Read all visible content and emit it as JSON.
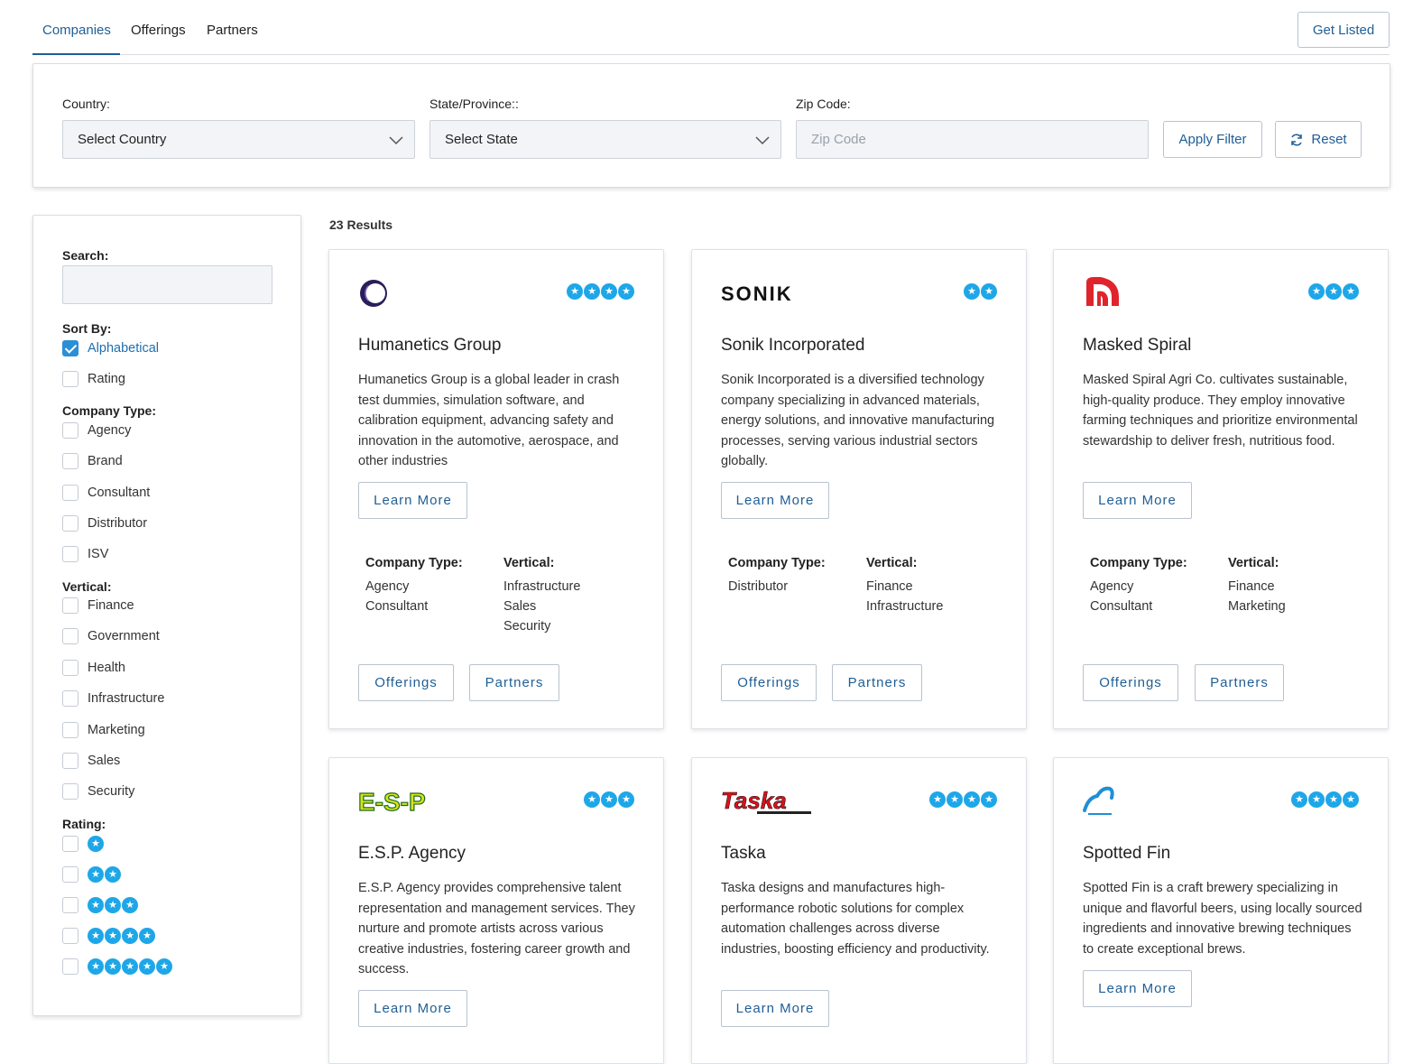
{
  "nav": {
    "tabs": [
      {
        "label": "Companies",
        "active": true
      },
      {
        "label": "Offerings",
        "active": false
      },
      {
        "label": "Partners",
        "active": false
      }
    ],
    "get_listed": "Get Listed"
  },
  "filters": {
    "country_label": "Country:",
    "country_value": "Select Country",
    "state_label": "State/Province::",
    "state_value": "Select State",
    "zip_label": "Zip Code:",
    "zip_placeholder": "Zip Code",
    "apply": "Apply Filter",
    "reset": "Reset"
  },
  "sidebar": {
    "search_label": "Search:",
    "sort_label": "Sort By:",
    "sort_options": [
      {
        "label": "Alphabetical",
        "checked": true
      },
      {
        "label": "Rating",
        "checked": false
      }
    ],
    "company_type_label": "Company Type:",
    "company_types": [
      "Agency",
      "Brand",
      "Consultant",
      "Distributor",
      "ISV"
    ],
    "vertical_label": "Vertical:",
    "verticals": [
      "Finance",
      "Government",
      "Health",
      "Infrastructure",
      "Marketing",
      "Sales",
      "Security"
    ],
    "rating_label": "Rating:",
    "ratings": [
      1,
      2,
      3,
      4,
      5
    ]
  },
  "results": {
    "count_text": "23 Results",
    "meta_type_label": "Company Type:",
    "meta_vertical_label": "Vertical:",
    "learn_more": "Learn More",
    "offerings": "Offerings",
    "partners": "Partners",
    "cards": [
      {
        "name": "Humanetics Group",
        "rating": 4,
        "logo": "humanetics-ring-logo",
        "description": "Humanetics Group is a global leader in crash test dummies, simulation software, and calibration equipment, advancing safety and innovation in the automotive, aerospace, and other industries",
        "company_types": [
          "Agency",
          "Consultant"
        ],
        "verticals": [
          "Infrastructure",
          "Sales",
          "Security"
        ]
      },
      {
        "name": "Sonik Incorporated",
        "rating": 2,
        "logo": "sonik-wordmark-logo",
        "logo_text": "SONIK",
        "description": "Sonik Incorporated is a diversified technology company specializing in advanced materials, energy solutions, and innovative manufacturing processes, serving various industrial sectors globally.",
        "company_types": [
          "Distributor"
        ],
        "verticals": [
          "Finance",
          "Infrastructure"
        ]
      },
      {
        "name": "Masked Spiral",
        "rating": 3,
        "logo": "masked-spiral-red-logo",
        "description": "Masked Spiral Agri Co. cultivates sustainable, high-quality produce. They employ innovative farming techniques and prioritize environmental stewardship to deliver fresh, nutritious food.",
        "company_types": [
          "Agency",
          "Consultant"
        ],
        "verticals": [
          "Finance",
          "Marketing"
        ]
      },
      {
        "name": "E.S.P. Agency",
        "rating": 3,
        "logo": "esp-wordmark-logo",
        "logo_text": "E-S-P",
        "description": "E.S.P. Agency provides comprehensive talent representation and management services. They nurture and promote artists across various creative industries, fostering career growth and success."
      },
      {
        "name": "Taska",
        "rating": 4,
        "logo": "taska-wordmark-logo",
        "logo_text": "Taska",
        "description": "Taska designs and manufactures high-performance robotic solutions for complex automation challenges across diverse industries, boosting efficiency and productivity."
      },
      {
        "name": "Spotted Fin",
        "rating": 4,
        "logo": "spotted-fin-logo",
        "description": "Spotted Fin is a craft brewery specializing in unique and flavorful beers, using locally sourced ingredients and innovative brewing techniques to create exceptional brews."
      }
    ]
  },
  "colors": {
    "accent": "#1f5e96",
    "star": "#1ea7e8",
    "checkbox_checked": "#2a8fd6",
    "border": "#d9dde3"
  }
}
